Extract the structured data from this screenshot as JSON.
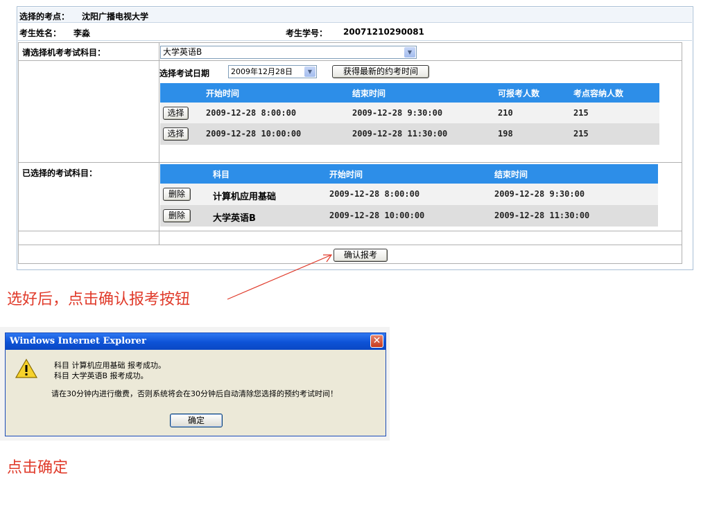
{
  "form": {
    "site_label": "选择的考点：",
    "site_value": "沈阳广播电视大学",
    "name_label": "考生姓名：",
    "name_value": "李淼",
    "id_label": "考生学号：",
    "id_value": "20071210290081",
    "select_subject_label": "请选择机考考试科目：",
    "subject_selected": "大学英语B",
    "select_date_label": "选择考试日期",
    "date_selected": "2009年12月28日",
    "refresh_button": "获得最新的约考时间",
    "selected_subjects_label": "已选择的考试科目：",
    "confirm_button": "确认报考"
  },
  "time_table": {
    "headers": [
      "",
      "开始时间",
      "结束时间",
      "可报考人数",
      "考点容纳人数"
    ],
    "rows": [
      {
        "action": "选择",
        "start": "2009-12-28 8:00:00",
        "end": "2009-12-28 9:30:00",
        "available": "210",
        "capacity": "215"
      },
      {
        "action": "选择",
        "start": "2009-12-28 10:00:00",
        "end": "2009-12-28 11:30:00",
        "available": "198",
        "capacity": "215"
      }
    ]
  },
  "chosen_table": {
    "headers": [
      "",
      "科目",
      "开始时间",
      "结束时间"
    ],
    "rows": [
      {
        "action": "删除",
        "subject": "计算机应用基础",
        "start": "2009-12-28 8:00:00",
        "end": "2009-12-28 9:30:00"
      },
      {
        "action": "删除",
        "subject": "大学英语B",
        "start": "2009-12-28 10:00:00",
        "end": "2009-12-28 11:30:00"
      }
    ]
  },
  "annotations": {
    "step1": "选好后，点击确认报考按钮",
    "step2": "点击确定"
  },
  "dialog": {
    "title": "Windows Internet Explorer",
    "close_icon": "close-icon",
    "warning_icon": "warning-icon",
    "line1": "科目 计算机应用基础 报考成功。",
    "line2": "科目 大学英语B 报考成功。",
    "line3": "请在30分钟内进行缴费，否则系统将会在30分钟后自动清除您选择的预约考试时间！",
    "ok_button": "确定"
  },
  "colors": {
    "table_header": "#2d8ee8",
    "annotation": "#e03a2a",
    "dialog_title": "#0d52d6"
  }
}
